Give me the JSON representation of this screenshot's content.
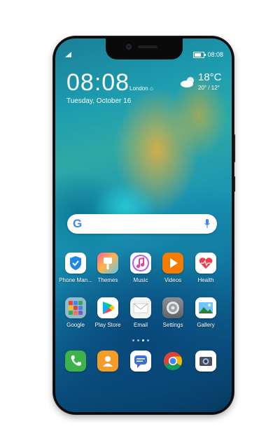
{
  "status_bar": {
    "time": "08:08"
  },
  "clock": {
    "time": "08:08",
    "city": "London",
    "date": "Tuesday, October 16"
  },
  "weather": {
    "temp": "18°C",
    "range": "20° / 12°"
  },
  "apps_row1": [
    {
      "label": "Phone Man...",
      "icon": "shield-icon"
    },
    {
      "label": "Themes",
      "icon": "brush-icon"
    },
    {
      "label": "Music",
      "icon": "music-note-icon"
    },
    {
      "label": "Videos",
      "icon": "play-icon"
    },
    {
      "label": "Health",
      "icon": "heart-icon"
    }
  ],
  "apps_row2": [
    {
      "label": "Google",
      "icon": "google-folder-icon"
    },
    {
      "label": "Play Store",
      "icon": "play-store-icon"
    },
    {
      "label": "Email",
      "icon": "envelope-icon"
    },
    {
      "label": "Settings",
      "icon": "gear-icon"
    },
    {
      "label": "Gallery",
      "icon": "picture-icon"
    }
  ],
  "dock": [
    {
      "icon": "phone-icon"
    },
    {
      "icon": "contacts-icon"
    },
    {
      "icon": "messages-icon"
    },
    {
      "icon": "chrome-icon"
    },
    {
      "icon": "camera-icon"
    }
  ],
  "page_indicator": {
    "pages": 4,
    "current": 3
  },
  "colors": {
    "phone_manager": "#1e88e5",
    "videos": "#f57c00",
    "dock_phone": "#3cb44a",
    "dock_contacts": "#f39c2a"
  }
}
